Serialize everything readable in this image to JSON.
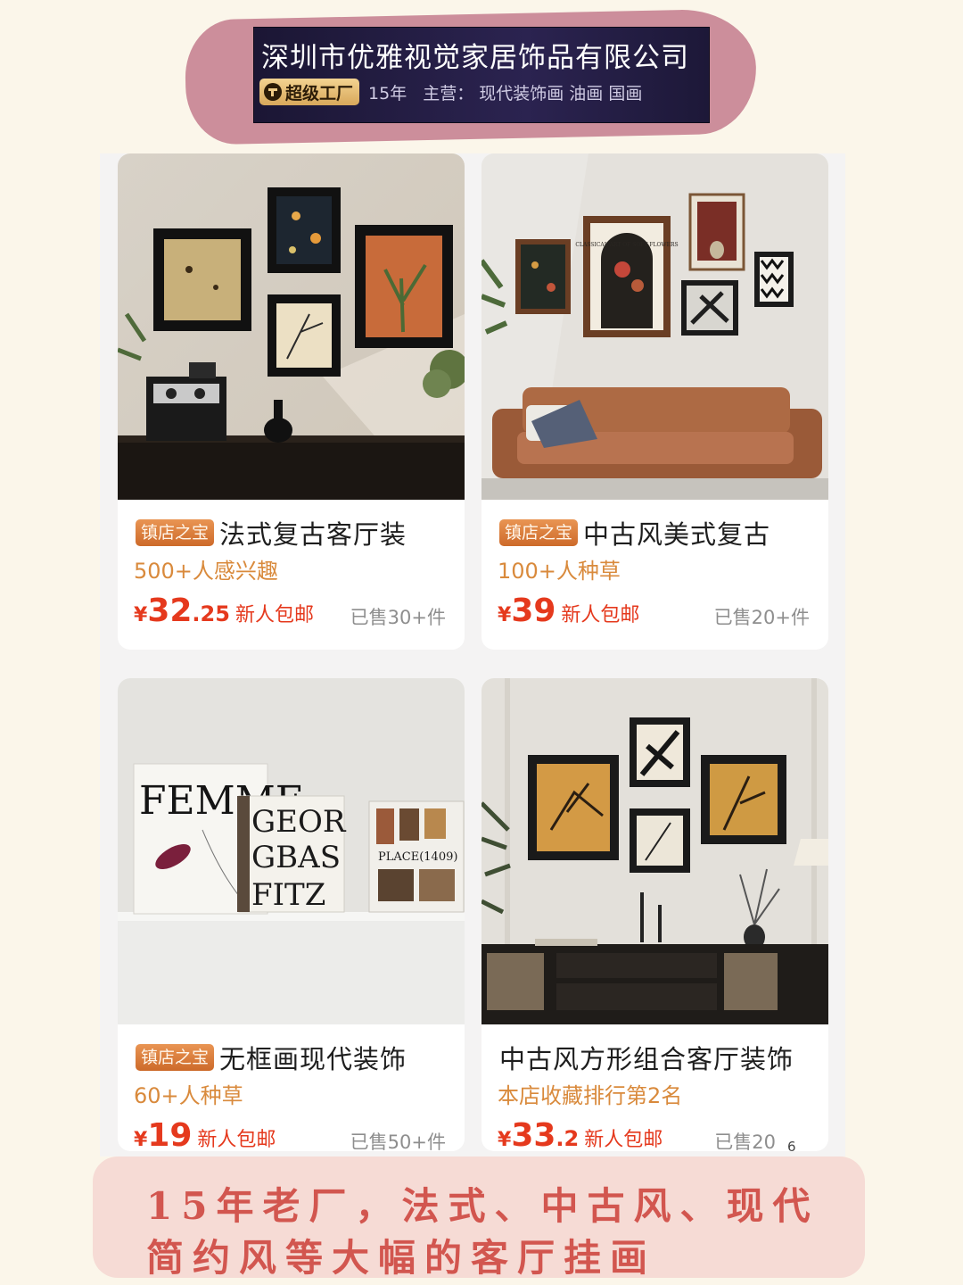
{
  "store": {
    "name": "深圳市优雅视觉家居饰品有限公司",
    "badge": "超级工厂",
    "years": "15年",
    "main_business": "主营：  现代装饰画 油画 国画",
    "colors": {
      "ribbon": "#cc8e9b",
      "header_bg": "#231d45",
      "badge_gold": "#e8bf76"
    }
  },
  "products": [
    {
      "badge": "镇店之宝",
      "title": "法式复古客厅装",
      "subtitle": "500+人感兴趣",
      "currency": "¥",
      "price_int": "32",
      "price_dec": ".25",
      "promo": "新人包邮",
      "sold": "已售30+件"
    },
    {
      "badge": "镇店之宝",
      "title": "中古风美式复古",
      "subtitle": "100+人种草",
      "currency": "¥",
      "price_int": "39",
      "price_dec": "",
      "promo": "新人包邮",
      "sold": "已售20+件"
    },
    {
      "badge": "镇店之宝",
      "title": "无框画现代装饰",
      "subtitle": "60+人种草",
      "currency": "¥",
      "price_int": "19",
      "price_dec": "",
      "promo": "新人包邮",
      "sold": "已售50+件"
    },
    {
      "badge": "",
      "title": "中古风方形组合客厅装饰",
      "subtitle": "本店收藏排行第2名",
      "currency": "¥",
      "price_int": "33",
      "price_dec": ".2",
      "promo": "新人包邮",
      "sold": "已售20"
    }
  ],
  "art_text": {
    "femme": "FEMME",
    "geor": "GEOR",
    "gbas": "GBAS",
    "fitz": "FITZ",
    "place": "PLACE(1409)",
    "classical": "CLASSICAL ART OF SOFT FLOWERS"
  },
  "caption": {
    "line1": "15年老厂，法式、中古风、现代",
    "line2": "简约风等大幅的客厅挂画",
    "color": "#d2564f"
  },
  "page_number": "6"
}
